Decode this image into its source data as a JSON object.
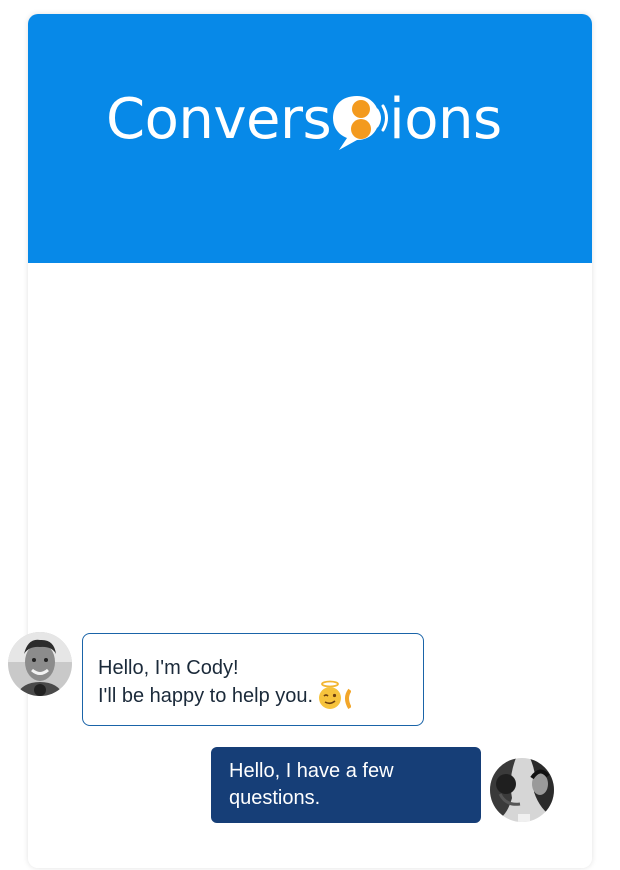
{
  "brand": {
    "logo_text_before": "Convers",
    "logo_text_after": "ions",
    "header_color": "#0789E8",
    "accent_color": "#F39A1E",
    "logo_icon": "speech-bubble-logo-icon"
  },
  "chat": {
    "messages": [
      {
        "sender": "agent",
        "avatar_icon": "agent-avatar-icon",
        "line1": "Hello, I'm Cody!",
        "line2": "I'll be happy to help you.",
        "emoji": "halo-wink-emoji-icon"
      },
      {
        "sender": "user",
        "avatar_icon": "user-avatar-icon",
        "text": "Hello, I have a few questions.",
        "bubble_color": "#163E77"
      }
    ]
  }
}
